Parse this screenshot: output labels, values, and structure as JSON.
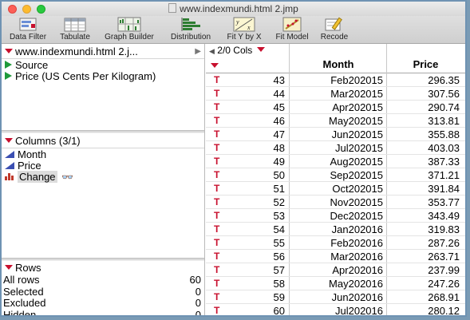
{
  "window": {
    "title": "www.indexmundi.html 2.jmp"
  },
  "toolbar": [
    {
      "label": "Data Filter",
      "icon": "data-filter-icon"
    },
    {
      "label": "Tabulate",
      "icon": "tabulate-icon"
    },
    {
      "label": "Graph Builder",
      "icon": "graph-builder-icon"
    },
    {
      "label": "Distribution",
      "icon": "distribution-icon"
    },
    {
      "label": "Fit Y by X",
      "icon": "fit-y-by-x-icon"
    },
    {
      "label": "Fit Model",
      "icon": "fit-model-icon"
    },
    {
      "label": "Recode",
      "icon": "recode-icon"
    }
  ],
  "table_panel": {
    "title": "www.indexmundi.html 2.j...",
    "scripts": [
      "Source",
      "Price (US Cents Per Kilogram)"
    ]
  },
  "columns_panel": {
    "title": "Columns (3/1)",
    "columns": [
      "Month",
      "Price",
      "Change"
    ]
  },
  "rows_panel": {
    "title": "Rows",
    "stats": [
      {
        "label": "All rows",
        "value": "60"
      },
      {
        "label": "Selected",
        "value": "0"
      },
      {
        "label": "Excluded",
        "value": "0"
      },
      {
        "label": "Hidden",
        "value": "0"
      }
    ]
  },
  "grid": {
    "cols_label": "2/0 Cols",
    "headers": {
      "month": "Month",
      "price": "Price"
    },
    "row_marker": "T",
    "rows": [
      {
        "n": "43",
        "month": "Feb202015",
        "price": "296.35"
      },
      {
        "n": "44",
        "month": "Mar202015",
        "price": "307.56"
      },
      {
        "n": "45",
        "month": "Apr202015",
        "price": "290.74"
      },
      {
        "n": "46",
        "month": "May202015",
        "price": "313.81"
      },
      {
        "n": "47",
        "month": "Jun202015",
        "price": "355.88"
      },
      {
        "n": "48",
        "month": "Jul202015",
        "price": "403.03"
      },
      {
        "n": "49",
        "month": "Aug202015",
        "price": "387.33"
      },
      {
        "n": "50",
        "month": "Sep202015",
        "price": "371.21"
      },
      {
        "n": "51",
        "month": "Oct202015",
        "price": "391.84"
      },
      {
        "n": "52",
        "month": "Nov202015",
        "price": "353.77"
      },
      {
        "n": "53",
        "month": "Dec202015",
        "price": "343.49"
      },
      {
        "n": "54",
        "month": "Jan202016",
        "price": "319.83"
      },
      {
        "n": "55",
        "month": "Feb202016",
        "price": "287.26"
      },
      {
        "n": "56",
        "month": "Mar202016",
        "price": "263.71"
      },
      {
        "n": "57",
        "month": "Apr202016",
        "price": "237.99"
      },
      {
        "n": "58",
        "month": "May202016",
        "price": "247.26"
      },
      {
        "n": "59",
        "month": "Jun202016",
        "price": "268.91"
      },
      {
        "n": "60",
        "month": "Jul202016",
        "price": "280.12"
      }
    ]
  }
}
